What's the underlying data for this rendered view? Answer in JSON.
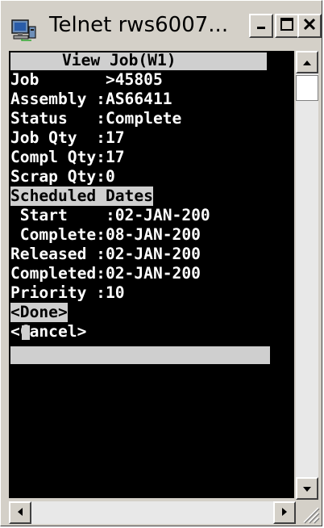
{
  "window": {
    "title": "Telnet rws6007..."
  },
  "terminal": {
    "header": "View Job(W1)",
    "lines": [
      "Job       >45805",
      "Assembly :AS66411",
      "Status   :Complete",
      "Job Qty  :17",
      "Compl Qty:17",
      "Scrap Qty:0",
      "Scheduled Dates",
      " Start    :02-JAN-200",
      " Complete:08-JAN-200",
      "Released :02-JAN-200",
      "Completed:02-JAN-200",
      "Priority :10",
      "<Done>",
      "<Cancel>"
    ]
  },
  "icons": {
    "app": "telnet-computer-icon",
    "minimize": "minimize-icon",
    "maximize": "maximize-icon",
    "close": "close-icon",
    "scroll_up": "arrow-up-icon",
    "scroll_down": "arrow-down-icon",
    "scroll_left": "arrow-left-icon",
    "scroll_right": "arrow-right-icon",
    "resize": "resize-grip-icon"
  },
  "colors": {
    "terminal_bg": "#000000",
    "terminal_fg": "#ffffff",
    "highlight_bg": "#cfcfcf",
    "chrome": "#d4d0c8"
  }
}
